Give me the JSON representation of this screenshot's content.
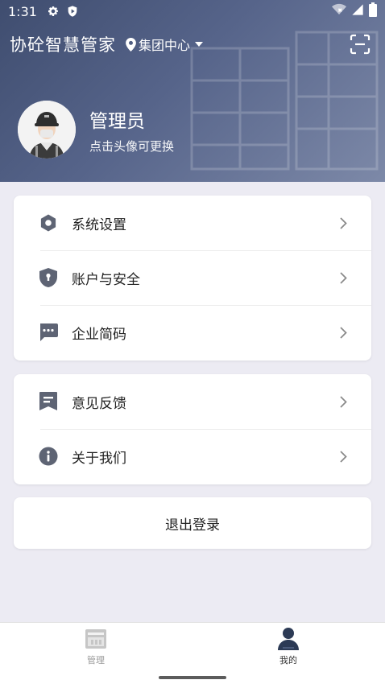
{
  "status_bar": {
    "time": "1:31"
  },
  "header": {
    "app_title": "协砼智慧管家",
    "location": "集团中心"
  },
  "profile": {
    "name": "管理员",
    "hint": "点击头像可更换"
  },
  "menu_group_1": [
    {
      "label": "系统设置",
      "icon": "gear-icon"
    },
    {
      "label": "账户与安全",
      "icon": "shield-icon"
    },
    {
      "label": "企业简码",
      "icon": "message-icon"
    }
  ],
  "menu_group_2": [
    {
      "label": "意见反馈",
      "icon": "feedback-icon"
    },
    {
      "label": "关于我们",
      "icon": "info-icon"
    }
  ],
  "logout_label": "退出登录",
  "bottom_nav": [
    {
      "label": "管理",
      "active": false
    },
    {
      "label": "我的",
      "active": true
    }
  ],
  "colors": {
    "header": "#4a5878",
    "icon": "#5e6474",
    "active_nav": "#333333",
    "inactive_nav": "#9b9b9b"
  }
}
